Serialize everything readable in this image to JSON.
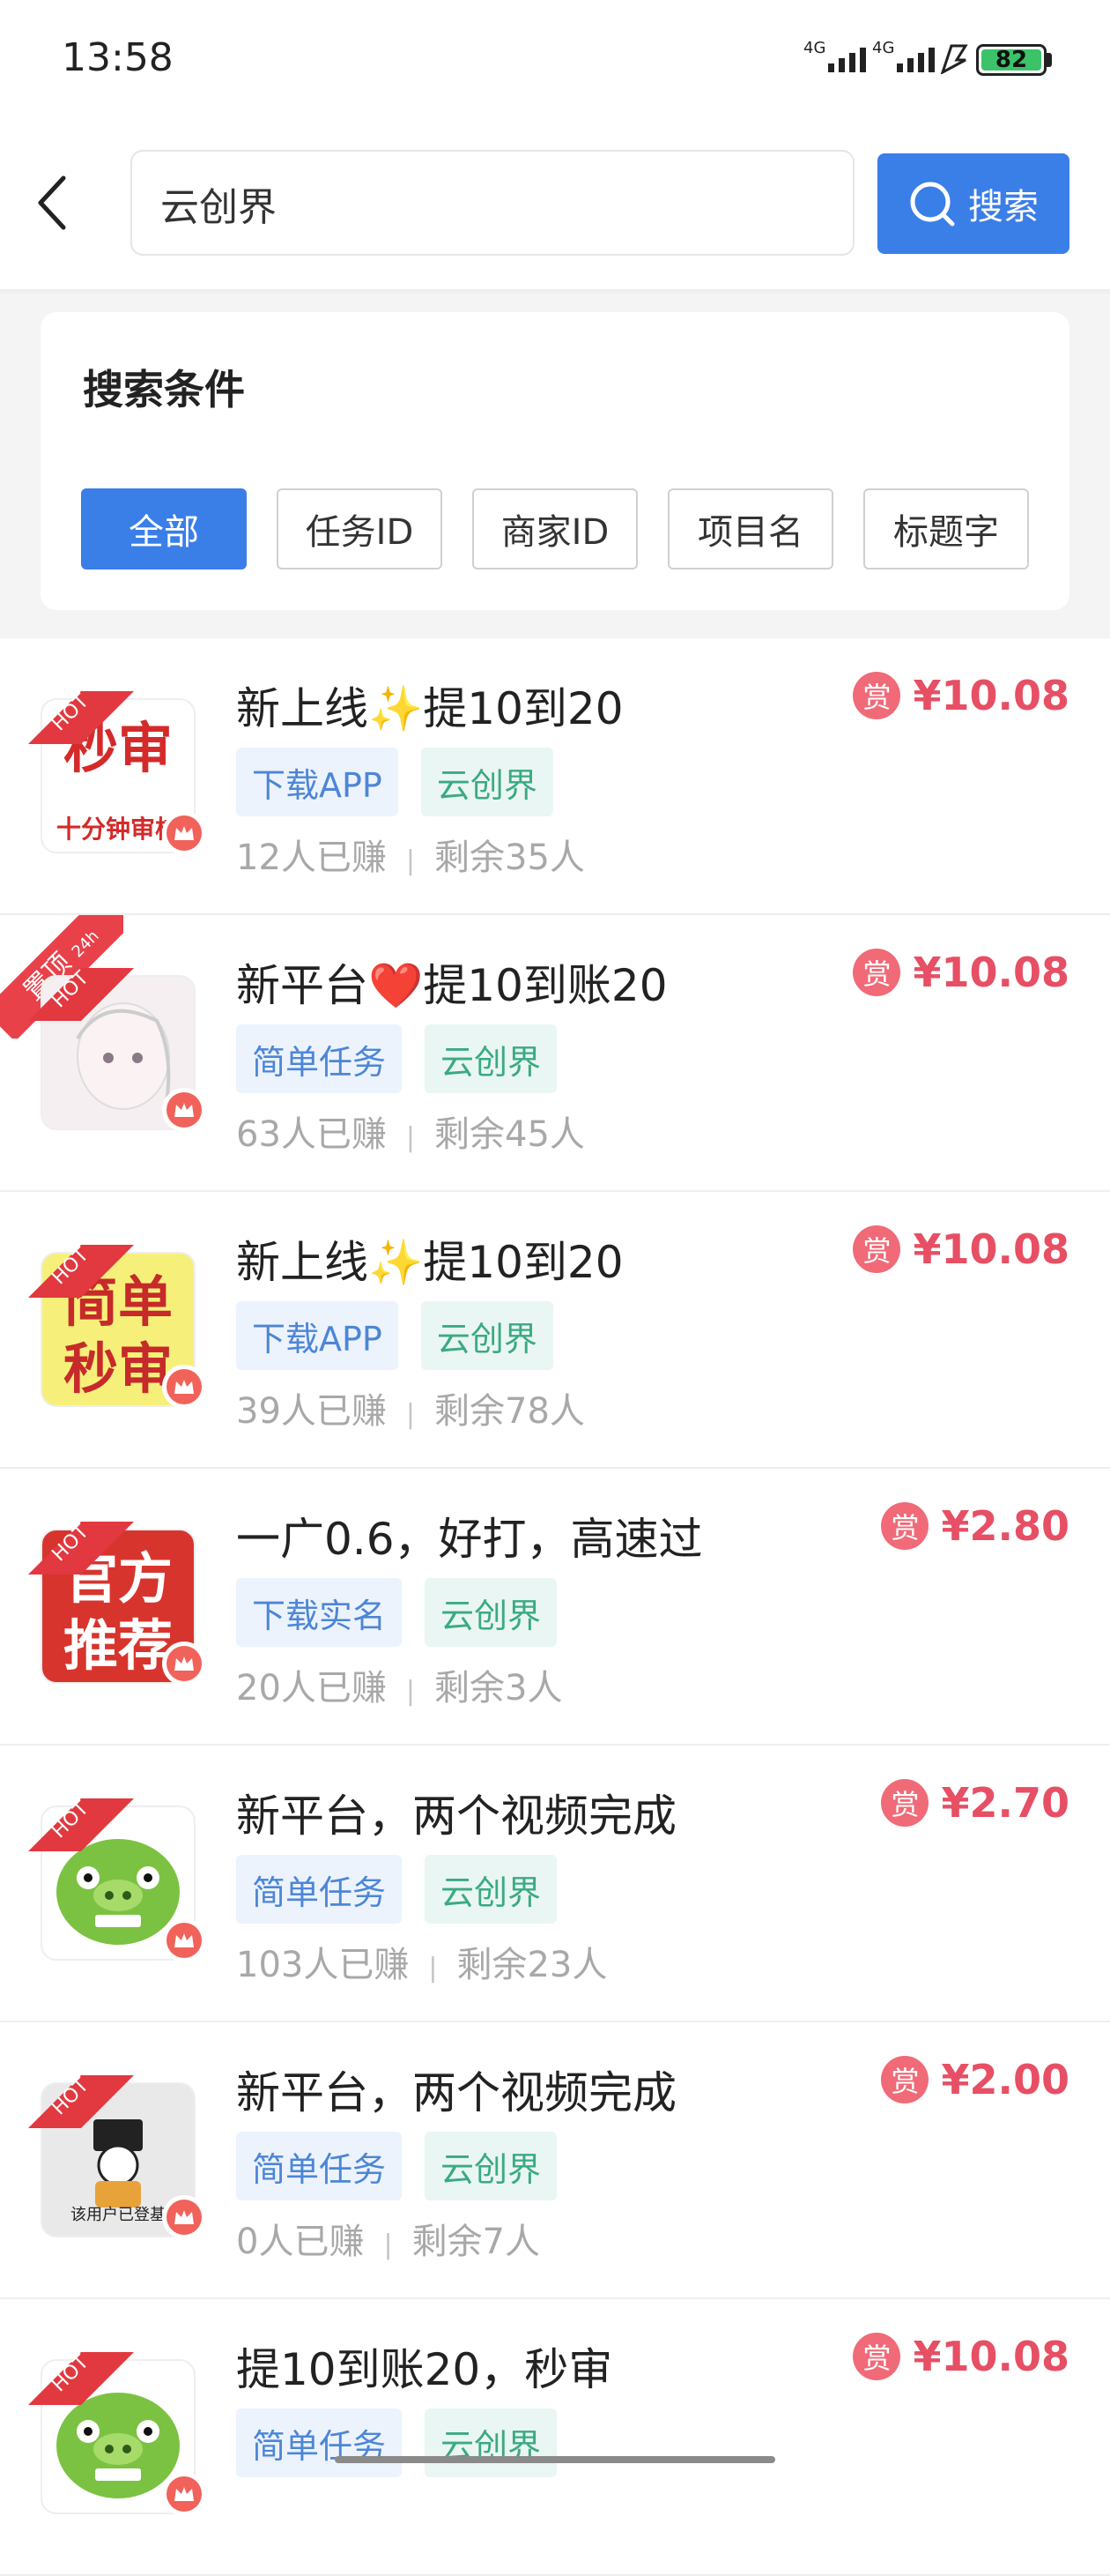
{
  "status_bar": {
    "time": "13:58",
    "net1": "4G",
    "net2": "4G",
    "battery": "82"
  },
  "search": {
    "value": "云创界",
    "button_label": "搜索"
  },
  "conditions": {
    "title": "搜索条件",
    "chips": [
      "全部",
      "任务ID",
      "商家ID",
      "项目名",
      "标题字"
    ],
    "active_index": 0
  },
  "hot_label": "HOT",
  "items": [
    {
      "title": "新上线✨提10到20",
      "tags": [
        "下载APP",
        "云创界"
      ],
      "earned": "12人已赚",
      "remaining": "剩余35人",
      "reward_badge": "赏",
      "reward": "¥10.08",
      "thumb_text": [
        "秒审",
        "十分钟审核"
      ],
      "pinned": false
    },
    {
      "title": "新平台❤️提10到账20",
      "tags": [
        "简单任务",
        "云创界"
      ],
      "earned": "63人已赚",
      "remaining": "剩余45人",
      "reward_badge": "赏",
      "reward": "¥10.08",
      "thumb_text": [],
      "pinned": true,
      "pin_label": "置顶",
      "pin_sub": "24h"
    },
    {
      "title": "新上线✨提10到20",
      "tags": [
        "下载APP",
        "云创界"
      ],
      "earned": "39人已赚",
      "remaining": "剩余78人",
      "reward_badge": "赏",
      "reward": "¥10.08",
      "thumb_text": [
        "简单",
        "秒审"
      ],
      "pinned": false
    },
    {
      "title": "一广0.6，好打，高速过",
      "tags": [
        "下载实名",
        "云创界"
      ],
      "earned": "20人已赚",
      "remaining": "剩余3人",
      "reward_badge": "赏",
      "reward": "¥2.80",
      "thumb_text": [
        "官方",
        "推荐"
      ],
      "pinned": false
    },
    {
      "title": "新平台，两个视频完成",
      "tags": [
        "简单任务",
        "云创界"
      ],
      "earned": "103人已赚",
      "remaining": "剩余23人",
      "reward_badge": "赏",
      "reward": "¥2.70",
      "thumb_text": [],
      "pinned": false
    },
    {
      "title": "新平台，两个视频完成",
      "tags": [
        "简单任务",
        "云创界"
      ],
      "earned": "0人已赚",
      "remaining": "剩余7人",
      "reward_badge": "赏",
      "reward": "¥2.00",
      "thumb_text": [
        "该用户已登基"
      ],
      "pinned": false
    },
    {
      "title": "提10到账20，秒审",
      "tags": [
        "简单任务",
        "云创界"
      ],
      "earned": "",
      "remaining": "",
      "reward_badge": "赏",
      "reward": "¥10.08",
      "thumb_text": [],
      "pinned": false
    }
  ]
}
